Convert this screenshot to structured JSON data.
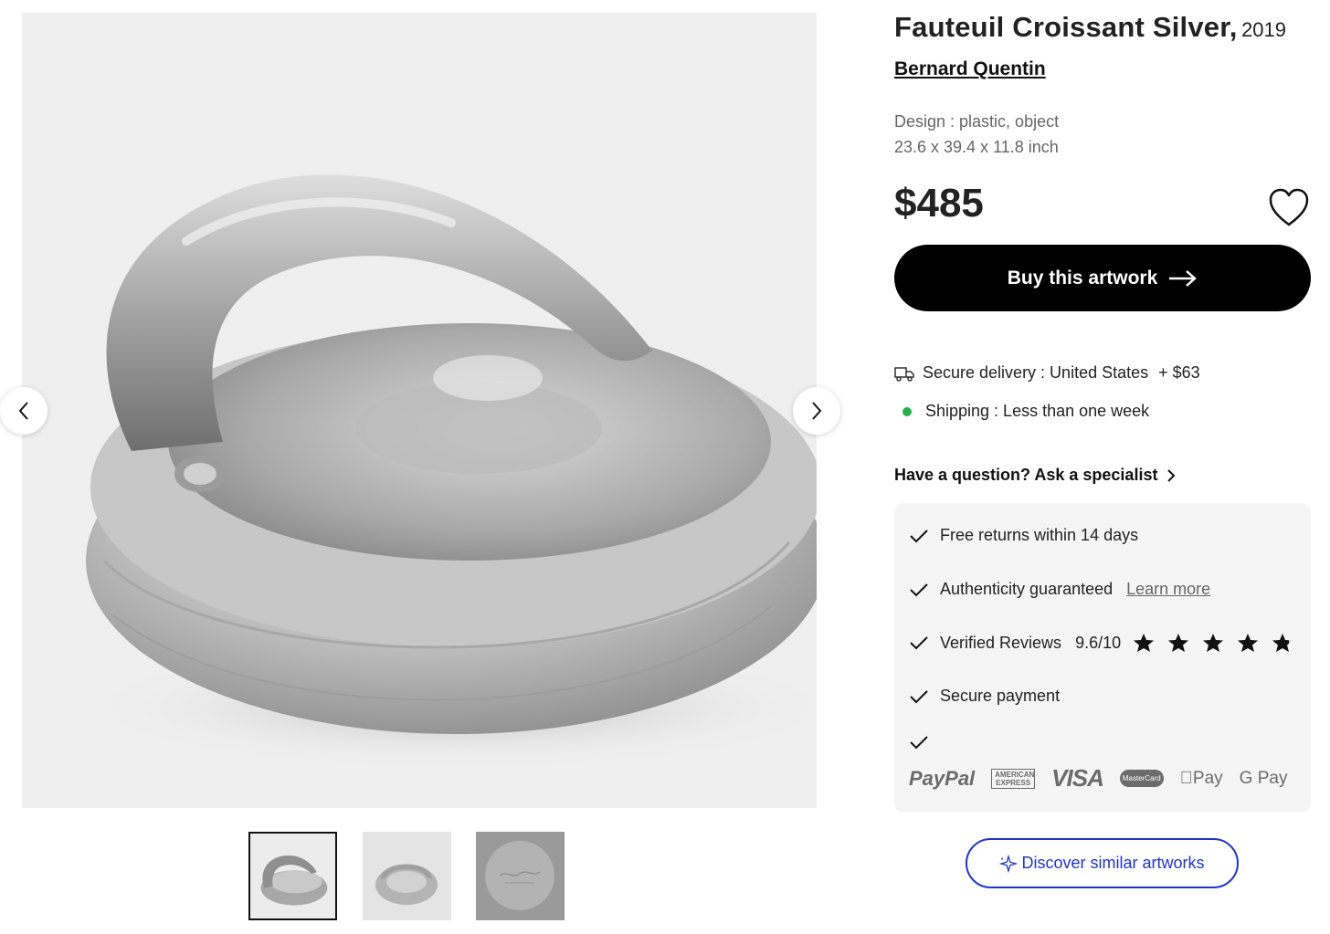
{
  "product": {
    "title": "Fauteuil Croissant Silver,",
    "year": "2019",
    "artist": "Bernard Quentin",
    "design": "Design : plastic, object",
    "dimensions": "23.6 x 39.4 x 11.8 inch",
    "price": "$485"
  },
  "actions": {
    "buy_label": "Buy this artwork",
    "discover_label": "Discover similar artworks"
  },
  "shipping": {
    "delivery_label": "Secure delivery : United States",
    "delivery_cost": "+ $63",
    "shipping_time": "Shipping : Less than one week"
  },
  "question_label": "Have a question? Ask a specialist",
  "guarantees": {
    "returns": "Free returns within 14 days",
    "authenticity": "Authenticity guaranteed",
    "learn_more": "Learn more",
    "reviews": "Verified Reviews",
    "reviews_score": "9.6/10",
    "rating_stars": 4.8,
    "secure_payment": "Secure payment"
  },
  "payment_methods": [
    "PayPal",
    "AMERICAN EXPRESS",
    "VISA",
    "MasterCard",
    "Pay",
    "G Pay"
  ],
  "gallery": {
    "thumbnail_count": 3,
    "active_index": 0
  },
  "colors": {
    "primary_button": "#000000",
    "accent_link": "#2233cc",
    "status_dot": "#21b34a"
  },
  "icons": [
    "chevron-left-icon",
    "chevron-right-icon",
    "heart-icon",
    "arrow-right-icon",
    "truck-icon",
    "check-icon",
    "star-icon",
    "sparkle-icon"
  ]
}
